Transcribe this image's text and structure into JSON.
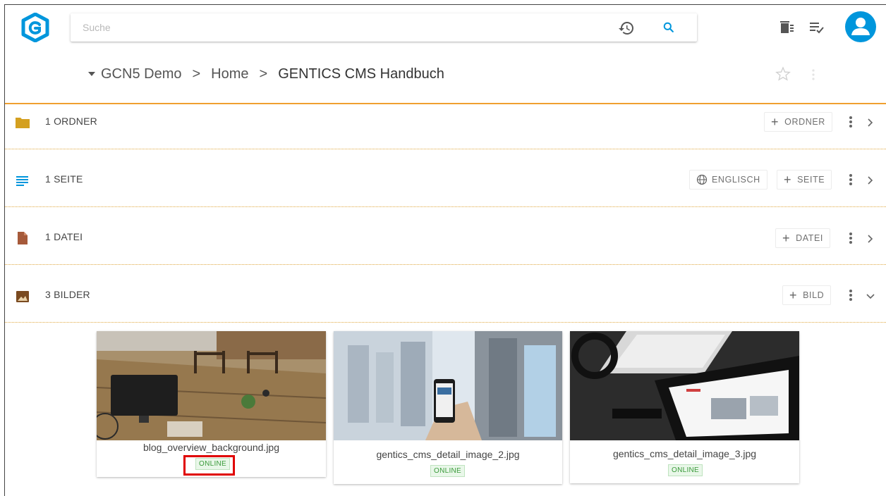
{
  "search": {
    "placeholder": "Suche"
  },
  "breadcrumb": {
    "items": [
      "GCN5 Demo",
      "Home",
      "GENTICS CMS Handbuch"
    ]
  },
  "sections": [
    {
      "title": "1 ORDNER",
      "button": "ORDNER",
      "chevron": "right"
    },
    {
      "title": "1 SEITE",
      "language": "ENGLISCH",
      "button": "SEITE",
      "chevron": "right"
    },
    {
      "title": "1 DATEI",
      "button": "DATEI",
      "chevron": "right"
    },
    {
      "title": "3 BILDER",
      "button": "BILD",
      "chevron": "down"
    }
  ],
  "images": [
    {
      "filename": "blog_overview_background.jpg",
      "status": "ONLINE"
    },
    {
      "filename": "gentics_cms_detail_image_2.jpg",
      "status": "ONLINE"
    },
    {
      "filename": "gentics_cms_detail_image_3.jpg",
      "status": "ONLINE"
    }
  ],
  "colors": {
    "accent": "#0096dc",
    "section_divider": "#f0a030",
    "folder": "#d4a020",
    "file": "#a65a3a",
    "image": "#7a4a20",
    "online": "#3a9a3a",
    "highlight": "#e00000"
  },
  "icons": {
    "logo": "gentics-logo",
    "history": "history-icon",
    "search": "search-icon",
    "wastebin": "wastebin-icon",
    "tasks": "task-list-icon",
    "user": "user-avatar-icon",
    "favourite": "star-outline-icon",
    "language": "globe-icon"
  }
}
